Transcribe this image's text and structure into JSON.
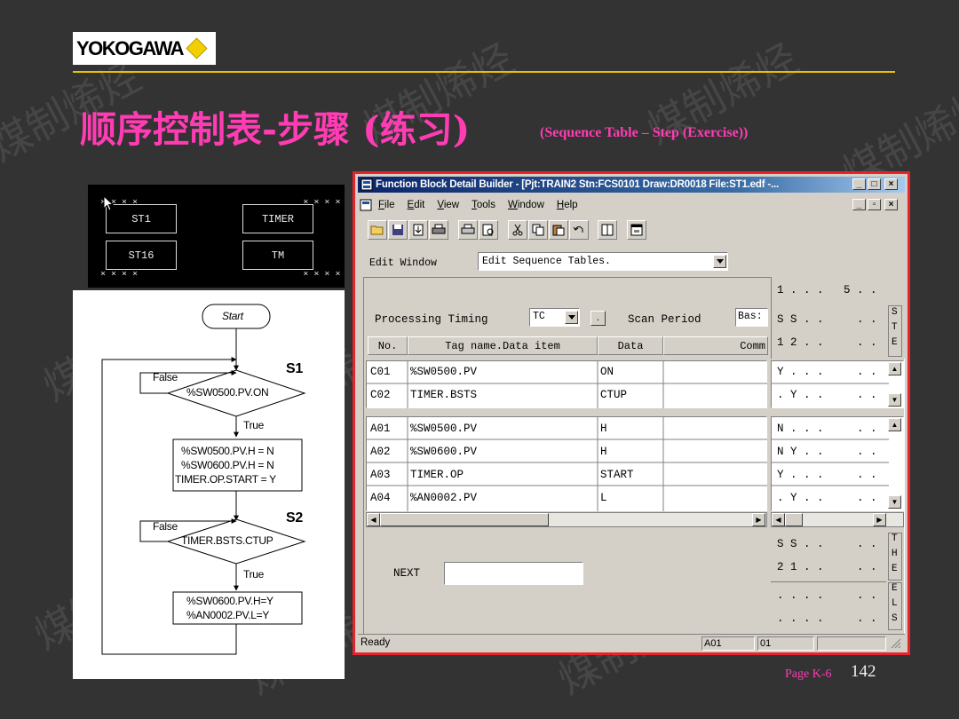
{
  "logo": {
    "text": "YOKOGAWA"
  },
  "title": "顺序控制表-步骤 (练习)",
  "subtitle": "(Sequence Table – Step (Exercise))",
  "faceplate": {
    "boxes": [
      {
        "label": "ST1"
      },
      {
        "label": "TIMER"
      },
      {
        "label": "ST16"
      },
      {
        "label": "TM"
      }
    ]
  },
  "flowchart": {
    "start": "Start",
    "s1_label": "S1",
    "s2_label": "S2",
    "false1": "False",
    "false2": "False",
    "true1": "True",
    "true2": "True",
    "cond1": "%SW0500.PV.ON",
    "cond2": "TIMER.BSTS.CTUP",
    "action1": [
      "%SW0500.PV.H = N",
      "%SW0600.PV.H = N",
      "TIMER.OP.START = Y"
    ],
    "action2": [
      "%SW0600.PV.H=Y",
      "%AN0002.PV.L=Y"
    ]
  },
  "window": {
    "title": "Function Block Detail Builder - [Pjt:TRAIN2 Stn:FCS0101 Draw:DR0018 File:ST1.edf -...",
    "menu": [
      {
        "key": "F",
        "rest": "ile"
      },
      {
        "key": "E",
        "rest": "dit"
      },
      {
        "key": "V",
        "rest": "iew"
      },
      {
        "key": "T",
        "rest": "ools"
      },
      {
        "key": "W",
        "rest": "indow"
      },
      {
        "key": "H",
        "rest": "elp"
      }
    ],
    "edit_window_label": "Edit Window",
    "edit_window_value": "Edit Sequence Tables.",
    "processing_timing_label": "Processing Timing",
    "processing_timing_value": "TC",
    "scan_period_label": "Scan Period",
    "scan_period_value": "Bas:",
    "columns": {
      "no": "No.",
      "tag": "Tag name.Data item",
      "data": "Data",
      "comment": "Comm"
    },
    "right_header_row1": "1 . . .   5 . .",
    "right_header_row2": "S S . .     . .",
    "right_header_row3": "1 2 . .     . .",
    "ste_letters": [
      "S",
      "T",
      "E"
    ],
    "conditions": [
      {
        "no": "C01",
        "tag": "%SW0500.PV",
        "data": "ON",
        "steps": "Y . . .     . ."
      },
      {
        "no": "C02",
        "tag": "TIMER.BSTS",
        "data": "CTUP",
        "steps": ". Y . .     . ."
      }
    ],
    "actions": [
      {
        "no": "A01",
        "tag": "%SW0500.PV",
        "data": "H",
        "steps": "N . . .     . ."
      },
      {
        "no": "A02",
        "tag": "%SW0600.PV",
        "data": "H",
        "steps": "N Y . .     . ."
      },
      {
        "no": "A03",
        "tag": "TIMER.OP",
        "data": "START",
        "steps": "Y . . .     . ."
      },
      {
        "no": "A04",
        "tag": "%AN0002.PV",
        "data": "L",
        "steps": ". Y . .     . ."
      }
    ],
    "next_label": "NEXT",
    "next_value": "",
    "then_rows": [
      "S S . .     . .",
      "2 1 . .     . ."
    ],
    "else_rows": [
      ". . . .     . .",
      ". . . .     . ."
    ],
    "then_letters": [
      "T",
      "H",
      "E"
    ],
    "else_letters": [
      "E",
      "L",
      "S"
    ],
    "status": {
      "text": "Ready",
      "cell1": "A01",
      "cell2": "01"
    }
  },
  "footer": {
    "page_label": "Page K-6",
    "page_number": "142"
  },
  "watermark": "煤制烯烃",
  "colors": {
    "background": "#333333",
    "title_pink": "#ff3cb4",
    "gold": "#e6c200",
    "window_border": "#e8232b"
  }
}
